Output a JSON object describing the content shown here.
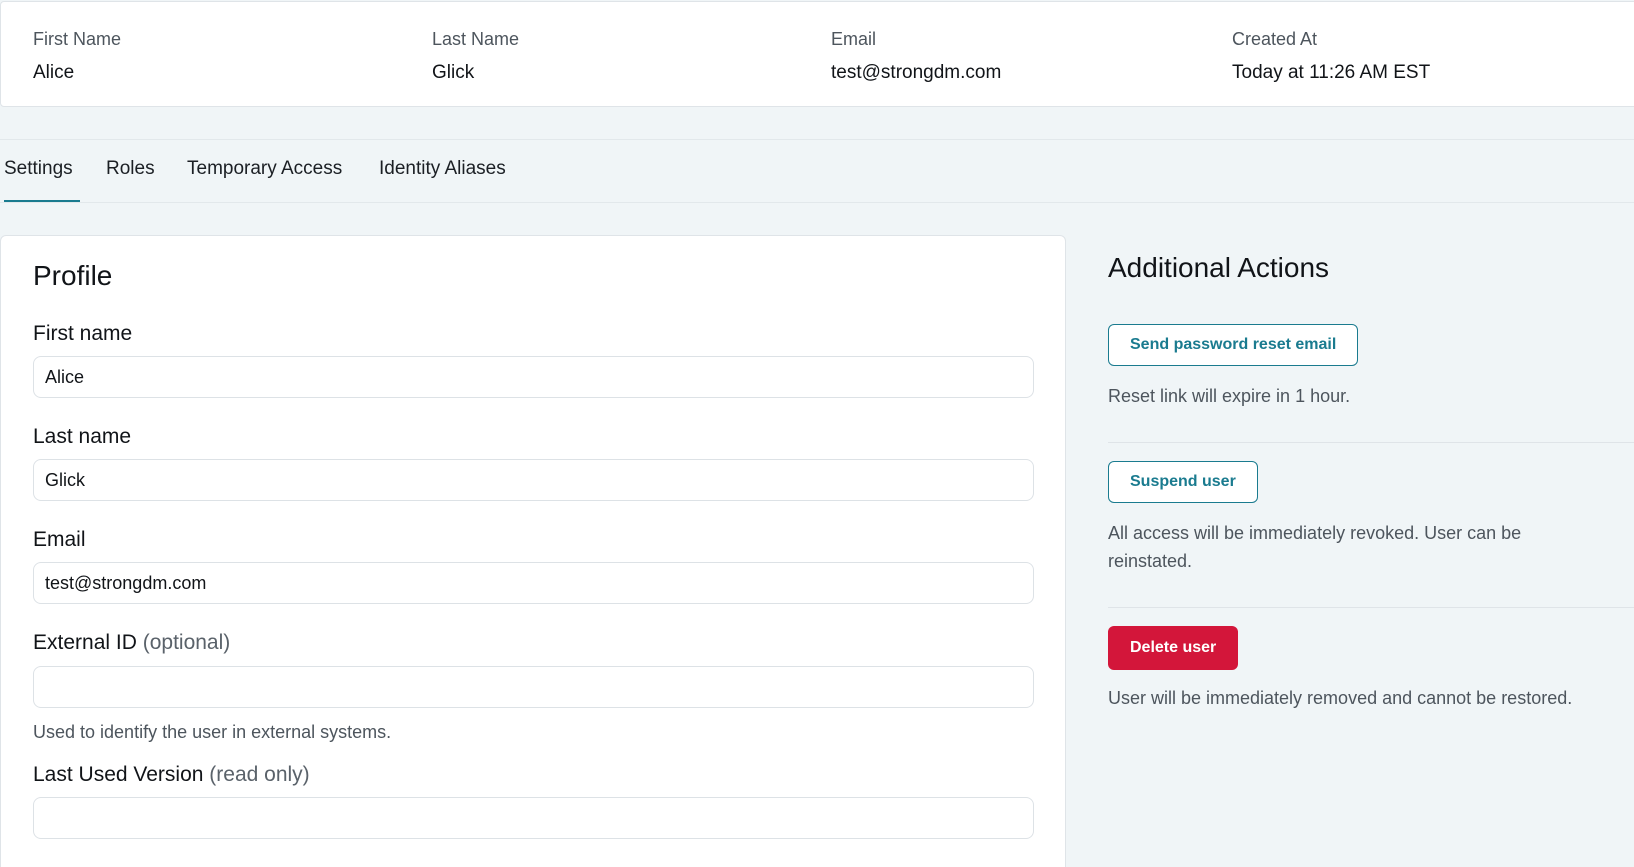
{
  "summary": {
    "first_name": {
      "label": "First Name",
      "value": "Alice"
    },
    "last_name": {
      "label": "Last Name",
      "value": "Glick"
    },
    "email": {
      "label": "Email",
      "value": "test@strongdm.com"
    },
    "created_at": {
      "label": "Created At",
      "value": "Today at 11:26 AM EST"
    }
  },
  "tabs": [
    {
      "label": "Settings",
      "active": true
    },
    {
      "label": "Roles",
      "active": false
    },
    {
      "label": "Temporary Access",
      "active": false
    },
    {
      "label": "Identity Aliases",
      "active": false
    }
  ],
  "profile": {
    "title": "Profile",
    "first_name": {
      "label": "First name",
      "value": "Alice"
    },
    "last_name": {
      "label": "Last name",
      "value": "Glick"
    },
    "email": {
      "label": "Email",
      "value": "test@strongdm.com"
    },
    "external_id": {
      "label": "External ID",
      "qualifier": "(optional)",
      "value": "",
      "help": "Used to identify the user in external systems."
    },
    "last_used_version": {
      "label": "Last Used Version",
      "qualifier": "(read only)",
      "value": ""
    }
  },
  "actions": {
    "title": "Additional Actions",
    "reset": {
      "button": "Send password reset email",
      "description": "Reset link will expire in 1 hour."
    },
    "suspend": {
      "button": "Suspend user",
      "description": "All access will be immediately revoked. User can be reinstated."
    },
    "delete": {
      "button": "Delete user",
      "description": "User will be immediately removed and cannot be restored."
    }
  },
  "colors": {
    "accent": "#1a7b8f",
    "danger": "#d3163a",
    "background": "#f0f5f7"
  }
}
